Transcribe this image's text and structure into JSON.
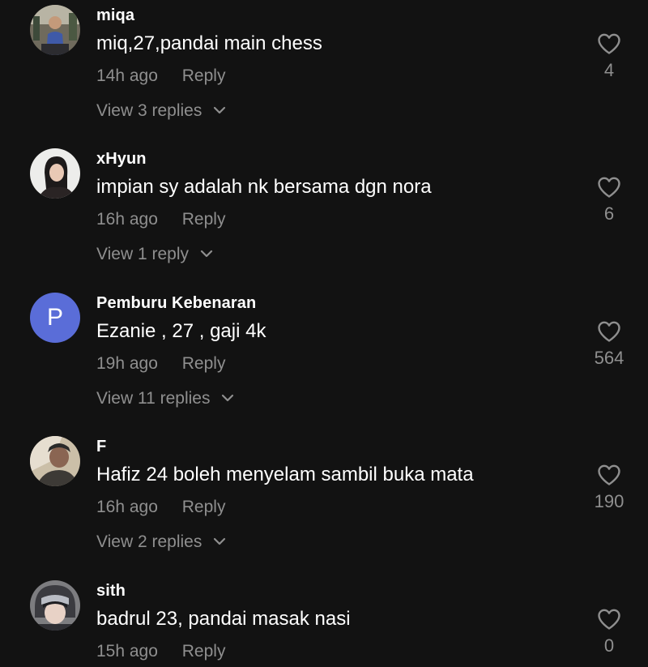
{
  "comments": [
    {
      "username": "miqa",
      "text": "miq,27,pandai main chess",
      "time": "14h ago",
      "reply_label": "Reply",
      "view_replies": "View 3 replies",
      "likes": "4",
      "avatar_icon": "user-photo-avatar"
    },
    {
      "username": "xHyun",
      "text": "impian sy adalah nk bersama dgn nora",
      "time": "16h ago",
      "reply_label": "Reply",
      "view_replies": "View 1 reply",
      "likes": "6",
      "avatar_icon": "user-photo-avatar"
    },
    {
      "username": "Pemburu Kebenaran",
      "text": "Ezanie , 27 , gaji 4k",
      "time": "19h ago",
      "reply_label": "Reply",
      "view_replies": "View 11 replies",
      "likes": "564",
      "avatar_letter": "P",
      "avatar_color": "#5a6dd8"
    },
    {
      "username": "F",
      "text": "Hafiz 24 boleh menyelam sambil buka mata",
      "time": "16h ago",
      "reply_label": "Reply",
      "view_replies": "View 2 replies",
      "likes": "190",
      "avatar_icon": "user-photo-avatar"
    },
    {
      "username": "sith",
      "text": "badrul 23, pandai masak nasi",
      "time": "15h ago",
      "reply_label": "Reply",
      "likes": "0",
      "avatar_icon": "user-photo-avatar"
    }
  ],
  "colors": {
    "background": "#121212",
    "primary_text": "#ffffff",
    "secondary_text": "#8f8f8f"
  },
  "icons": [
    "heart-outline-icon",
    "chevron-down-icon"
  ]
}
